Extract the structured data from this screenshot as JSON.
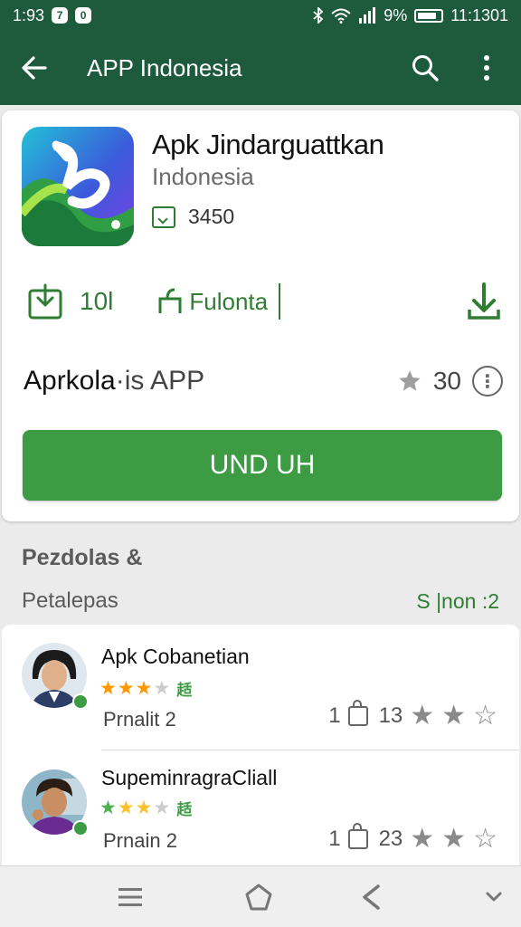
{
  "status_bar": {
    "time": "1:93",
    "badge1": "7",
    "badge2": "0",
    "battery": "9%",
    "clock_right": "11:1301"
  },
  "app_bar": {
    "title": "APP Indonesia",
    "back_icon": "arrow-left-icon",
    "search_icon": "search-icon",
    "menu_icon": "more-vert-icon"
  },
  "app": {
    "name": "Apk Jindarguattkan",
    "developer": "Indonesia",
    "size": "3450",
    "stat_count": "10l",
    "stat_label": "Fulonta",
    "type_label_bold": "Aprkola",
    "type_label_rest": "·is APP",
    "rating": "30",
    "install_label": "UND UH",
    "colors": {
      "primary": "#1e5b3c",
      "accent": "#3d9b43"
    }
  },
  "section": {
    "title": "Pezdolas &",
    "subtitle": "Petalepas",
    "link": "S |non :2"
  },
  "reviews": [
    {
      "name": "Apk Cobanetian",
      "stars": [
        "#ff9800",
        "#ff9800",
        "#ff9800",
        "#cccccc"
      ],
      "tag": "趏",
      "sub": "Prnalit 2",
      "left_count": "1",
      "right_count": "13"
    },
    {
      "name": "SupeminragraCliall",
      "stars": [
        "#4caf50",
        "#fbc02d",
        "#fbc02d",
        "#cccccc"
      ],
      "tag": "趏",
      "sub": "Prnain 2",
      "left_count": "1",
      "right_count": "23"
    }
  ],
  "nav": {
    "menu_icon": "menu-icon",
    "home_icon": "home-icon",
    "back_icon": "back-icon",
    "down_icon": "chevron-down-icon"
  }
}
